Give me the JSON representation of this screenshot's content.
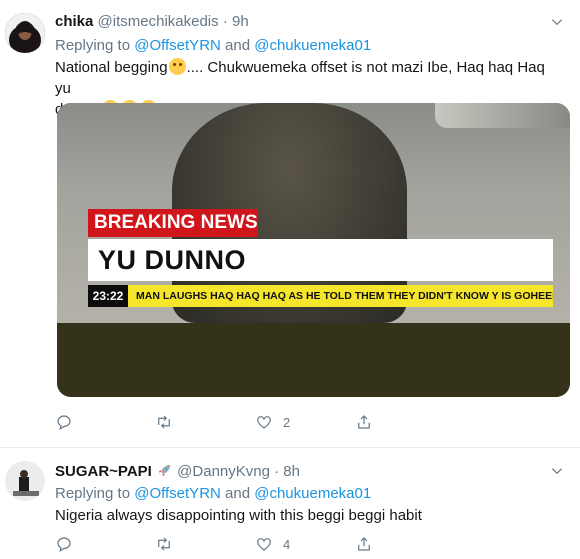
{
  "tweets": [
    {
      "name": "chika",
      "handle": "@itsmechikakedis",
      "separator": "·",
      "time": "9h",
      "replying_prefix": "Replying to",
      "replying_user1": "@OffsetYRN",
      "replying_and": "and",
      "replying_user2": "@chukuemeka01",
      "text_line1": "National begging",
      "text_line1_rest": ".... Chukwuemeka offset is not mazi Ibe, Haq haq Haq yu",
      "text_line2": "dunno",
      "media": {
        "breaking_label": "BREAKING NEWS",
        "headline": "YU DUNNO",
        "ticker_time": "23:22",
        "ticker_text": "MAN LAUGHS HAQ HAQ HAQ AS HE TOLD THEM THEY DIDN'T KNOW Y IS GOHEEN ON"
      },
      "reply_count": "",
      "retweet_count": "",
      "like_count": "2"
    },
    {
      "name": "SUGAR~PAPI",
      "handle": "@DannyKvng",
      "separator": "·",
      "time": "8h",
      "replying_prefix": "Replying to",
      "replying_user1": "@OffsetYRN",
      "replying_and": "and",
      "replying_user2": "@chukuemeka01",
      "text_line1": "Nigeria always disappointing with this beggi beggi habit",
      "reply_count": "",
      "retweet_count": "",
      "like_count": "4"
    }
  ],
  "colors": {
    "link": "#1b95e0",
    "muted": "#657786",
    "divider": "#e6ecf0",
    "breaking": "#d0161b",
    "ticker": "#f5e62b"
  },
  "icons": [
    "reply-icon",
    "retweet-icon",
    "like-icon",
    "share-icon",
    "chevron-down-icon",
    "rocket-emoji",
    "smiling-emoji",
    "tears-of-joy-emoji"
  ]
}
